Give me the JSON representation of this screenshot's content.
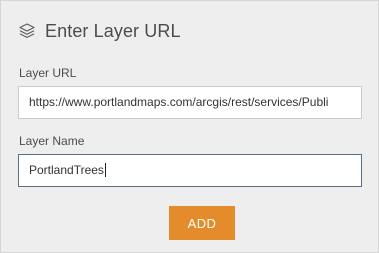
{
  "dialog": {
    "title": "Enter Layer URL",
    "title_icon": "layers-icon"
  },
  "layer_url": {
    "label": "Layer URL",
    "value": "https://www.portlandmaps.com/arcgis/rest/services/Publi"
  },
  "layer_name": {
    "label": "Layer Name",
    "value": "PortlandTrees"
  },
  "actions": {
    "add_label": "ADD",
    "add_color": "#e48c2c"
  },
  "colors": {
    "panel_background": "#eeeeee",
    "text": "#4c4c4c",
    "focused_border": "#5a6f86"
  }
}
